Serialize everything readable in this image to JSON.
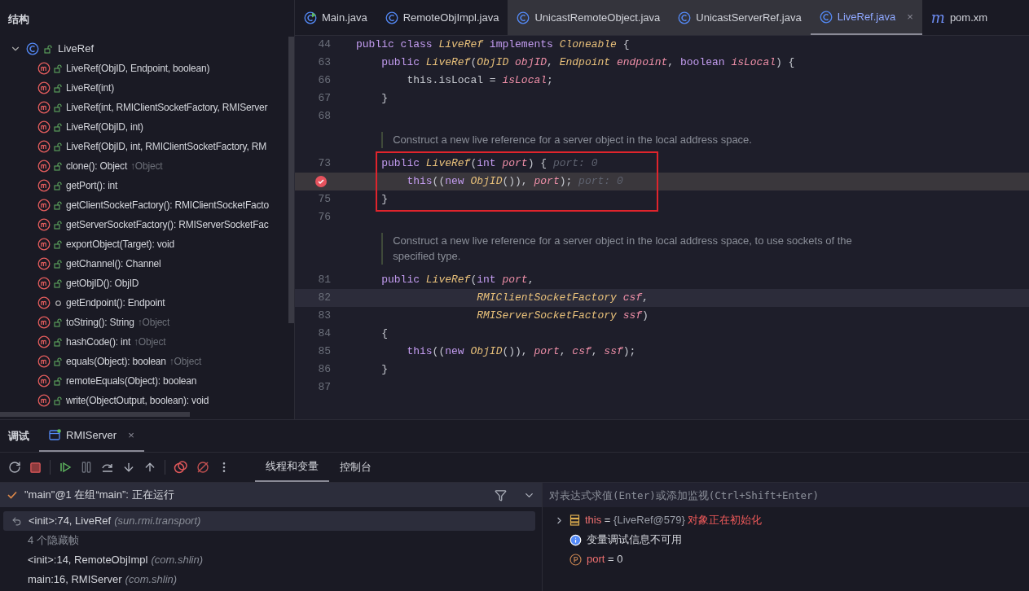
{
  "structure": {
    "title": "结构",
    "root": {
      "label": "LiveRef",
      "expanded": true,
      "children": [
        {
          "label": "LiveRef(ObjID, Endpoint, boolean)",
          "kind": "public"
        },
        {
          "label": "LiveRef(int)",
          "kind": "public"
        },
        {
          "label": "LiveRef(int, RMIClientSocketFactory, RMIServer",
          "kind": "public"
        },
        {
          "label": "LiveRef(ObjID, int)",
          "kind": "public"
        },
        {
          "label": "LiveRef(ObjID, int, RMIClientSocketFactory, RM",
          "kind": "public"
        },
        {
          "label": "clone(): Object",
          "inherited": "↑Object",
          "kind": "public"
        },
        {
          "label": "getPort(): int",
          "kind": "public"
        },
        {
          "label": "getClientSocketFactory(): RMIClientSocketFacto",
          "kind": "public"
        },
        {
          "label": "getServerSocketFactory(): RMIServerSocketFac",
          "kind": "public"
        },
        {
          "label": "exportObject(Target): void",
          "kind": "public"
        },
        {
          "label": "getChannel(): Channel",
          "kind": "public"
        },
        {
          "label": "getObjID(): ObjID",
          "kind": "public"
        },
        {
          "label": "getEndpoint(): Endpoint",
          "kind": "package"
        },
        {
          "label": "toString(): String",
          "inherited": "↑Object",
          "kind": "public"
        },
        {
          "label": "hashCode(): int",
          "inherited": "↑Object",
          "kind": "public"
        },
        {
          "label": "equals(Object): boolean",
          "inherited": "↑Object",
          "kind": "public"
        },
        {
          "label": "remoteEquals(Object): boolean",
          "kind": "public"
        },
        {
          "label": "write(ObjectOutput, boolean): void",
          "kind": "public"
        }
      ]
    }
  },
  "editor_tabs": [
    {
      "label": "Main.java",
      "kind": "main",
      "selected": false,
      "shaded": false
    },
    {
      "label": "RemoteObjImpl.java",
      "kind": "class",
      "selected": false,
      "shaded": false
    },
    {
      "label": "UnicastRemoteObject.java",
      "kind": "class",
      "selected": false,
      "shaded": true
    },
    {
      "label": "UnicastServerRef.java",
      "kind": "class",
      "selected": false,
      "shaded": true
    },
    {
      "label": "LiveRef.java",
      "kind": "class",
      "selected": true,
      "shaded": true,
      "close": "×"
    },
    {
      "label": "pom.xm",
      "kind": "maven",
      "icon_text": "m",
      "selected": false,
      "shaded": false
    }
  ],
  "code": [
    {
      "kind": "code",
      "number": "44",
      "tokens": [
        {
          "kind": "kw",
          "text": "public class"
        },
        {
          "kind": "type",
          "text": "LiveRef"
        },
        {
          "kind": "kw",
          "text": "implements"
        },
        {
          "kind": "type",
          "text": "Cloneable"
        },
        {
          "kind": "plain",
          "text": "{"
        }
      ],
      "children": [
        {
          "kind": "code",
          "number": "63",
          "tokens": [
            {
              "kind": "kw",
              "text": "public"
            },
            {
              "kind": "type",
              "text": "LiveRef"
            },
            {
              "kind": "plain",
              "text": "("
            },
            {
              "kind": "type",
              "text": "ObjID"
            },
            {
              "kind": "param",
              "text": "objID"
            },
            {
              "kind": "plain",
              "text": ","
            },
            {
              "kind": "type",
              "text": "Endpoint"
            },
            {
              "kind": "param",
              "text": "endpoint"
            },
            {
              "kind": "plain",
              "text": ","
            },
            {
              "kind": "kw",
              "text": "boolean"
            },
            {
              "kind": "param",
              "text": "isLocal"
            },
            {
              "kind": "plain",
              "text": ") {"
            }
          ],
          "children": [
            {
              "kind": "code",
              "number": "66",
              "tokens": [
                {
                  "kind": "plain",
                  "text": "this.isLocal ="
                },
                {
                  "kind": "param",
                  "text": "isLocal"
                },
                {
                  "kind": "plain",
                  "text": ";"
                }
              ]
            }
          ]
        },
        {
          "kind": "code",
          "number": "67",
          "tokens": [
            {
              "kind": "plain",
              "text": "}"
            }
          ]
        },
        {
          "kind": "code",
          "number": "68"
        },
        {
          "kind": "doc",
          "text": "Construct a new live reference for a server object in the local address space."
        },
        {
          "kind": "code",
          "number": "73",
          "boxed": true,
          "tokens": [
            {
              "kind": "kw",
              "text": "public"
            },
            {
              "kind": "type",
              "text": "LiveRef"
            },
            {
              "kind": "plain",
              "text": "("
            },
            {
              "kind": "kw",
              "text": "int"
            },
            {
              "kind": "param",
              "text": "port"
            },
            {
              "kind": "plain",
              "text": ") {"
            },
            {
              "kind": "hint",
              "text": "port: 0"
            }
          ],
          "children": [
            {
              "kind": "code",
              "breakpoint": true,
              "execution": true,
              "boxed": true,
              "tokens": [
                {
                  "kind": "kw",
                  "text": "this"
                },
                {
                  "kind": "plain",
                  "text": "(("
                },
                {
                  "kind": "kw",
                  "text": "new"
                },
                {
                  "kind": "type",
                  "text": "ObjID"
                },
                {
                  "kind": "plain",
                  "text": "()),"
                },
                {
                  "kind": "param",
                  "text": "port"
                },
                {
                  "kind": "plain",
                  "text": ");"
                },
                {
                  "kind": "hint",
                  "text": "port: 0"
                }
              ]
            }
          ]
        },
        {
          "kind": "code",
          "number": "75",
          "boxed": true,
          "tokens": [
            {
              "kind": "plain",
              "text": "}"
            }
          ]
        },
        {
          "kind": "code",
          "number": "76"
        },
        {
          "kind": "doc",
          "text": "Construct a new live reference for a server object in the local address space, to use sockets of the specified type."
        },
        {
          "kind": "code",
          "number": "81",
          "tokens": [
            {
              "kind": "kw",
              "text": "public"
            },
            {
              "kind": "type",
              "text": "LiveRef"
            },
            {
              "kind": "plain",
              "text": "("
            },
            {
              "kind": "kw",
              "text": "int"
            },
            {
              "kind": "param",
              "text": "port"
            },
            {
              "kind": "plain",
              "text": ","
            }
          ],
          "children": [
            {
              "kind": "continuation",
              "number": "82",
              "caret": true,
              "tokens": [
                {
                  "kind": "type",
                  "text": "RMIClientSocketFactory"
                },
                {
                  "kind": "param",
                  "text": "csf"
                },
                {
                  "kind": "plain",
                  "text": ","
                }
              ]
            },
            {
              "kind": "continuation",
              "number": "83",
              "tokens": [
                {
                  "kind": "type",
                  "text": "RMIServerSocketFactory"
                },
                {
                  "kind": "param",
                  "text": "ssf"
                },
                {
                  "kind": "plain",
                  "text": ")"
                }
              ]
            }
          ]
        },
        {
          "kind": "code",
          "number": "84",
          "tokens": [
            {
              "kind": "plain",
              "text": "{"
            }
          ],
          "children": [
            {
              "kind": "code",
              "number": "85",
              "tokens": [
                {
                  "kind": "kw",
                  "text": "this"
                },
                {
                  "kind": "plain",
                  "text": "(("
                },
                {
                  "kind": "kw",
                  "text": "new"
                },
                {
                  "kind": "type",
                  "text": "ObjID"
                },
                {
                  "kind": "plain",
                  "text": "()),"
                },
                {
                  "kind": "param",
                  "text": "port"
                },
                {
                  "kind": "plain",
                  "text": ","
                },
                {
                  "kind": "param",
                  "text": "csf"
                },
                {
                  "kind": "plain",
                  "text": ","
                },
                {
                  "kind": "param",
                  "text": "ssf"
                },
                {
                  "kind": "plain",
                  "text": ");"
                }
              ]
            }
          ]
        },
        {
          "kind": "code",
          "number": "86",
          "tokens": [
            {
              "kind": "plain",
              "text": "}"
            }
          ]
        },
        {
          "kind": "code",
          "number": "87"
        }
      ]
    }
  ],
  "debug": {
    "title": "调试",
    "session_tab": {
      "label": "RMIServer",
      "close": "×"
    },
    "view_tabs": [
      {
        "label": "线程和变量",
        "selected": true
      },
      {
        "label": "控制台",
        "selected": false
      }
    ],
    "thread": "\"main\"@1 在组“main”: 正在运行",
    "frames": [
      {
        "kind": "frame",
        "method": "<init>:74, LiveRef",
        "package": "(sun.rmi.transport)",
        "selected": true
      },
      {
        "kind": "hidden",
        "method": "4 个隐藏帧",
        "selected": false
      },
      {
        "kind": "frame",
        "method": "<init>:14, RemoteObjImpl",
        "package": "(com.shlin)",
        "selected": false
      },
      {
        "kind": "frame",
        "method": "main:16, RMIServer",
        "package": "(com.shlin)",
        "selected": false
      }
    ],
    "evaluate": {
      "placeholder": "对表达式求值(Enter)或添加监视(Ctrl+Shift+Enter)"
    },
    "variables": [
      {
        "kind": "object",
        "name": "this",
        "separator": "=",
        "value": "{LiveRef@579}",
        "note": "对象正在初始化",
        "expanded": false
      },
      {
        "kind": "info",
        "text": "变量调试信息不可用"
      },
      {
        "kind": "param",
        "name": "port",
        "separator": "=",
        "value": "0"
      }
    ]
  }
}
